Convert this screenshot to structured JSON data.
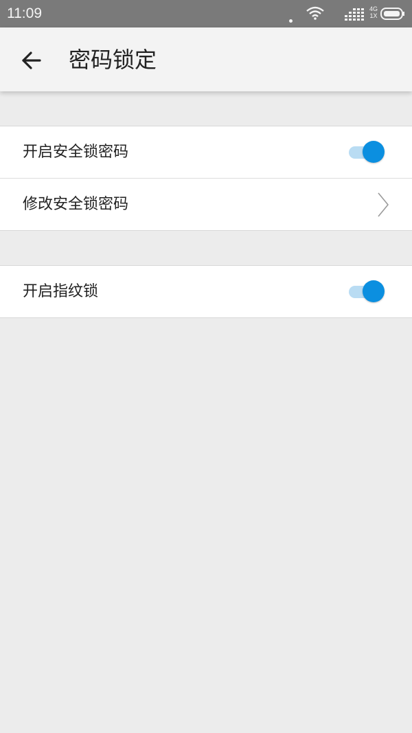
{
  "status_bar": {
    "time": "11:09",
    "network_top": "4G",
    "network_bottom": "1X",
    "icons": [
      "more-dots-icon",
      "wifi-icon",
      "signal-icon",
      "battery-icon"
    ]
  },
  "header": {
    "back_icon": "arrow-left-icon",
    "title": "密码锁定"
  },
  "settings": {
    "security_group": {
      "enable_security_lock_label": "开启安全锁密码",
      "enable_security_lock_state": true,
      "change_security_lock_label": "修改安全锁密码"
    },
    "fingerprint_group": {
      "enable_fingerprint_label": "开启指纹锁",
      "enable_fingerprint_state": true
    }
  },
  "colors": {
    "status_bar": "#7a7a7a",
    "app_bar": "#f3f3f3",
    "background": "#ececec",
    "accent": "#0b8fe0",
    "toggle_track_on": "#b9dcf3"
  }
}
